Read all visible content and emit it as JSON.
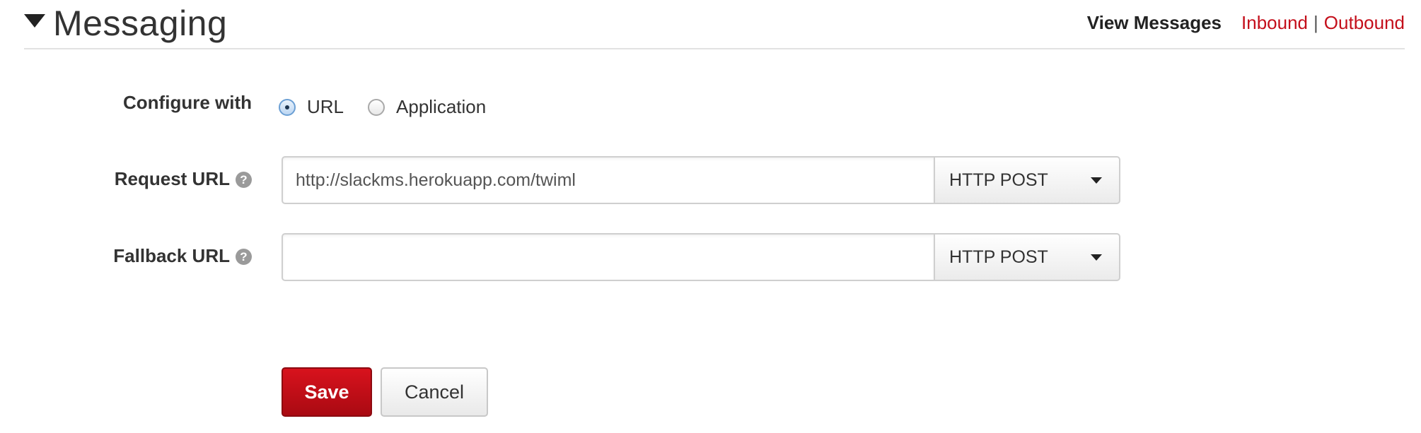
{
  "header": {
    "title": "Messaging",
    "view_label": "View Messages",
    "inbound_link": "Inbound",
    "separator": "|",
    "outbound_link": "Outbound"
  },
  "form": {
    "configure_label": "Configure with",
    "radio_options": [
      {
        "label": "URL",
        "checked": true
      },
      {
        "label": "Application",
        "checked": false
      }
    ],
    "request_url": {
      "label": "Request URL",
      "value": "http://slackms.herokuapp.com/twiml",
      "method": "HTTP POST"
    },
    "fallback_url": {
      "label": "Fallback URL",
      "value": "",
      "method": "HTTP POST"
    },
    "help_glyph": "?"
  },
  "actions": {
    "save_label": "Save",
    "cancel_label": "Cancel"
  },
  "colors": {
    "link": "#c40f1b",
    "save_button": "#c40f1b",
    "radio_selected": "#6b9fd4"
  },
  "icons": {
    "collapse": "triangle-down-icon",
    "help": "question-circle-icon",
    "dropdown": "caret-down-icon"
  }
}
